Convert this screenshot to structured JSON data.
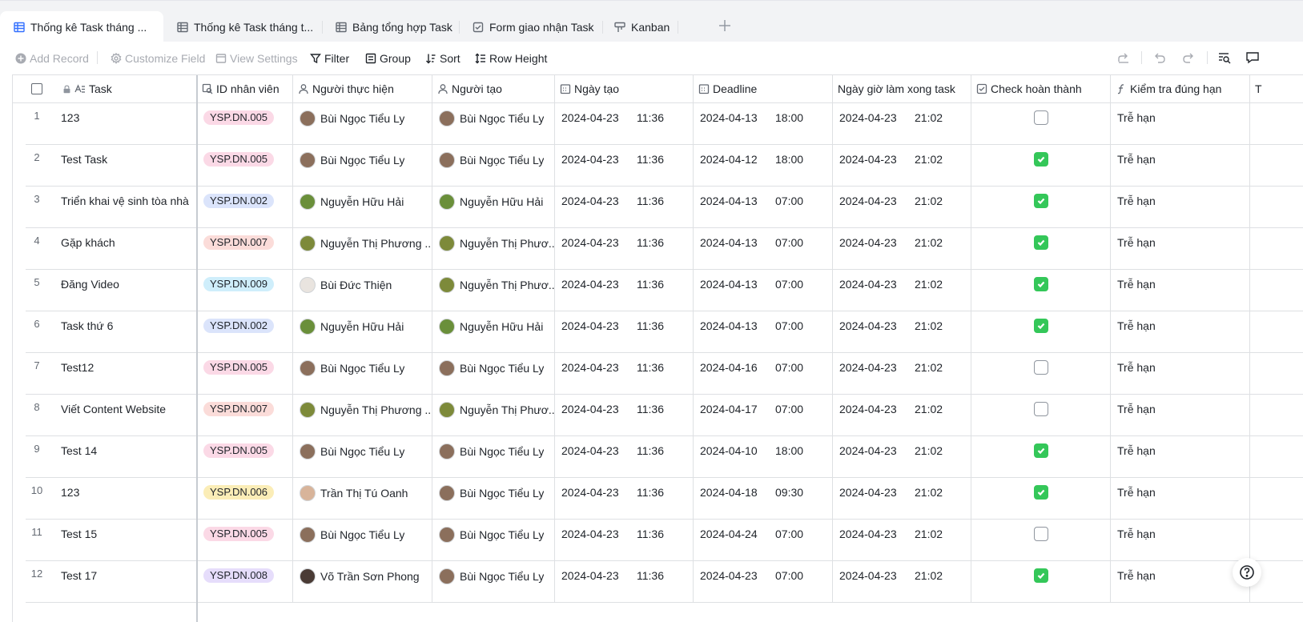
{
  "tabs": [
    {
      "label": "Thống kê Task tháng ...",
      "icon": "grid-icon",
      "active": true
    },
    {
      "label": "Thống kê Task tháng t...",
      "icon": "grid-icon",
      "active": false
    },
    {
      "label": "Bảng tổng hợp Task",
      "icon": "grid-icon",
      "active": false
    },
    {
      "label": "Form giao nhận Task",
      "icon": "form-icon",
      "active": false
    },
    {
      "label": "Kanban",
      "icon": "kanban-icon",
      "active": false
    }
  ],
  "toolbar": {
    "add_record": "Add Record",
    "customize_field": "Customize Field",
    "view_settings": "View Settings",
    "filter": "Filter",
    "group": "Group",
    "sort": "Sort",
    "row_height": "Row Height"
  },
  "columns": {
    "task": "Task",
    "id": "ID nhân viên",
    "assignee": "Người thực hiện",
    "creator": "Người tạo",
    "created": "Ngày tạo",
    "deadline": "Deadline",
    "done_at": "Ngày giờ làm xong task",
    "check": "Check hoàn thành",
    "ontime": "Kiểm tra đúng hạn",
    "next": "T"
  },
  "tag_colors": {
    "YSP.DN.005": "#fbd9e6",
    "YSP.DN.002": "#dbe4fb",
    "YSP.DN.007": "#fbdcd9",
    "YSP.DN.009": "#cfeefb",
    "YSP.DN.006": "#fbedb7",
    "YSP.DN.008": "#e6ddfb"
  },
  "avatar_colors": {
    "Bùi Ngọc Tiểu Ly": "#8b6f5c",
    "Nguyễn Hữu Hải": "#6a8f3a",
    "Nguyễn Thị Phương ...": "#7d8a3a",
    "Nguyễn Thị Phươ...": "#7d8a3a",
    "Bùi Đức Thiện": "#e9e4df",
    "Trần Thị Tú Oanh": "#d8b49a",
    "Võ Trần Sơn Phong": "#4a3b35"
  },
  "rows": [
    {
      "n": "1",
      "task": "123",
      "id": "YSP.DN.005",
      "assignee": "Bùi Ngọc Tiểu Ly",
      "creator": "Bùi Ngọc Tiểu Ly",
      "created_d": "2024-04-23",
      "created_t": "11:36",
      "deadline_d": "2024-04-13",
      "deadline_t": "18:00",
      "done_d": "2024-04-23",
      "done_t": "21:02",
      "checked": false,
      "ontime": "Trễ hạn"
    },
    {
      "n": "2",
      "task": "Test Task",
      "id": "YSP.DN.005",
      "assignee": "Bùi Ngọc Tiểu Ly",
      "creator": "Bùi Ngọc Tiểu Ly",
      "created_d": "2024-04-23",
      "created_t": "11:36",
      "deadline_d": "2024-04-12",
      "deadline_t": "18:00",
      "done_d": "2024-04-23",
      "done_t": "21:02",
      "checked": true,
      "ontime": "Trễ hạn"
    },
    {
      "n": "3",
      "task": "Triển khai vệ sinh tòa nhà",
      "id": "YSP.DN.002",
      "assignee": "Nguyễn Hữu Hải",
      "creator": "Nguyễn Hữu Hải",
      "created_d": "2024-04-23",
      "created_t": "11:36",
      "deadline_d": "2024-04-13",
      "deadline_t": "07:00",
      "done_d": "2024-04-23",
      "done_t": "21:02",
      "checked": true,
      "ontime": "Trễ hạn"
    },
    {
      "n": "4",
      "task": "Gặp khách",
      "id": "YSP.DN.007",
      "assignee": "Nguyễn Thị Phương ...",
      "creator": "Nguyễn Thị Phươ...",
      "created_d": "2024-04-23",
      "created_t": "11:36",
      "deadline_d": "2024-04-13",
      "deadline_t": "07:00",
      "done_d": "2024-04-23",
      "done_t": "21:02",
      "checked": true,
      "ontime": "Trễ hạn"
    },
    {
      "n": "5",
      "task": "Đăng Video",
      "id": "YSP.DN.009",
      "assignee": "Bùi Đức Thiện",
      "creator": "Nguyễn Thị Phươ...",
      "created_d": "2024-04-23",
      "created_t": "11:36",
      "deadline_d": "2024-04-13",
      "deadline_t": "07:00",
      "done_d": "2024-04-23",
      "done_t": "21:02",
      "checked": true,
      "ontime": "Trễ hạn"
    },
    {
      "n": "6",
      "task": "Task thứ 6",
      "id": "YSP.DN.002",
      "assignee": "Nguyễn Hữu Hải",
      "creator": "Nguyễn Hữu Hải",
      "created_d": "2024-04-23",
      "created_t": "11:36",
      "deadline_d": "2024-04-13",
      "deadline_t": "07:00",
      "done_d": "2024-04-23",
      "done_t": "21:02",
      "checked": true,
      "ontime": "Trễ hạn"
    },
    {
      "n": "7",
      "task": "Test12",
      "id": "YSP.DN.005",
      "assignee": "Bùi Ngọc Tiểu Ly",
      "creator": "Bùi Ngọc Tiểu Ly",
      "created_d": "2024-04-23",
      "created_t": "11:36",
      "deadline_d": "2024-04-16",
      "deadline_t": "07:00",
      "done_d": "2024-04-23",
      "done_t": "21:02",
      "checked": false,
      "ontime": "Trễ hạn"
    },
    {
      "n": "8",
      "task": "Viết Content Website",
      "id": "YSP.DN.007",
      "assignee": "Nguyễn Thị Phương ...",
      "creator": "Nguyễn Thị Phươ...",
      "created_d": "2024-04-23",
      "created_t": "11:36",
      "deadline_d": "2024-04-17",
      "deadline_t": "07:00",
      "done_d": "2024-04-23",
      "done_t": "21:02",
      "checked": false,
      "ontime": "Trễ hạn"
    },
    {
      "n": "9",
      "task": "Test 14",
      "id": "YSP.DN.005",
      "assignee": "Bùi Ngọc Tiểu Ly",
      "creator": "Bùi Ngọc Tiểu Ly",
      "created_d": "2024-04-23",
      "created_t": "11:36",
      "deadline_d": "2024-04-10",
      "deadline_t": "18:00",
      "done_d": "2024-04-23",
      "done_t": "21:02",
      "checked": true,
      "ontime": "Trễ hạn"
    },
    {
      "n": "10",
      "task": "123",
      "id": "YSP.DN.006",
      "assignee": "Trần Thị Tú Oanh",
      "creator": "Bùi Ngọc Tiểu Ly",
      "created_d": "2024-04-23",
      "created_t": "11:36",
      "deadline_d": "2024-04-18",
      "deadline_t": "09:30",
      "done_d": "2024-04-23",
      "done_t": "21:02",
      "checked": true,
      "ontime": "Trễ hạn"
    },
    {
      "n": "11",
      "task": "Test 15",
      "id": "YSP.DN.005",
      "assignee": "Bùi Ngọc Tiểu Ly",
      "creator": "Bùi Ngọc Tiểu Ly",
      "created_d": "2024-04-23",
      "created_t": "11:36",
      "deadline_d": "2024-04-24",
      "deadline_t": "07:00",
      "done_d": "2024-04-23",
      "done_t": "21:02",
      "checked": false,
      "ontime": "Trễ hạn"
    },
    {
      "n": "12",
      "task": "Test 17",
      "id": "YSP.DN.008",
      "assignee": "Võ Trần Sơn Phong",
      "creator": "Bùi Ngọc Tiểu Ly",
      "created_d": "2024-04-23",
      "created_t": "11:36",
      "deadline_d": "2024-04-23",
      "deadline_t": "07:00",
      "done_d": "2024-04-23",
      "done_t": "21:02",
      "checked": true,
      "ontime": "Trễ hạn"
    }
  ]
}
